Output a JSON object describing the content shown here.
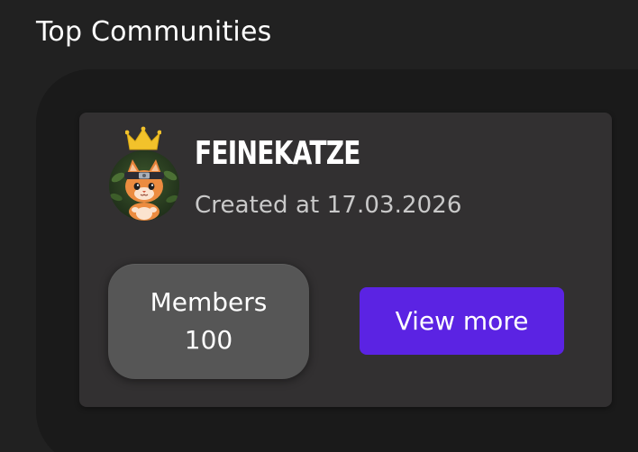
{
  "section": {
    "title": "Top Communities"
  },
  "community": {
    "name": "FEINEKATZE",
    "created_label": "Created at",
    "created_date": "17.03.2026",
    "members_label": "Members",
    "members_count": "100",
    "view_more_label": "View more",
    "icons": {
      "crown": "crown-icon",
      "avatar": "cat-avatar"
    }
  },
  "colors": {
    "page_bg": "#212121",
    "panel_bg": "#1a1a1a",
    "card_bg": "#323031",
    "members_bg": "#565656",
    "accent": "#5b23e3",
    "crown": "#f2c22b"
  }
}
